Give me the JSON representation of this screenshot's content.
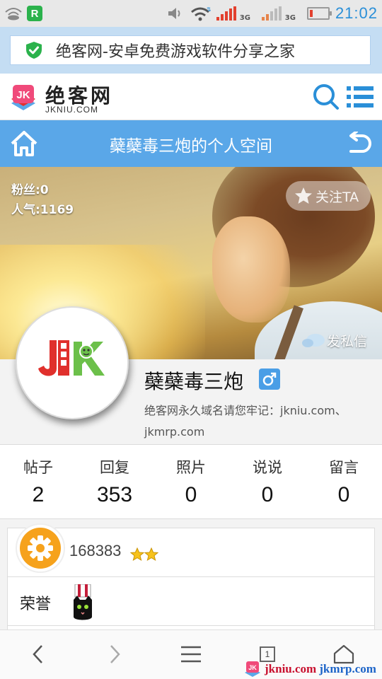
{
  "status_bar": {
    "app_badge": "R",
    "network_tag_1": "3G",
    "network_tag_2": "3G",
    "time": "21:02",
    "battery_level": 0.1
  },
  "banner": {
    "text": "绝客网-安卓免费游戏软件分享之家"
  },
  "header": {
    "logo_cn": "绝客网",
    "logo_en": "JKNIU.COM",
    "logo_mark": "JK"
  },
  "title_bar": {
    "title": "蘗蘗毒三炮的个人空间"
  },
  "cover": {
    "fans": "粉丝:0",
    "popularity": "人气:1169",
    "follow_label": "关注TA",
    "private_message_label": "发私信"
  },
  "profile": {
    "avatar_text": "JK",
    "username": "蘗蘗毒三炮",
    "gender": "male",
    "signature": "绝客网永久域名请您牢记：jkniu.com、jkmrp.com"
  },
  "stats": [
    {
      "label": "帖子",
      "value": "2"
    },
    {
      "label": "回复",
      "value": "353"
    },
    {
      "label": "照片",
      "value": "0"
    },
    {
      "label": "说说",
      "value": "0"
    },
    {
      "label": "留言",
      "value": "0"
    }
  ],
  "details": {
    "uid": "168383",
    "honor_label": "荣誉"
  },
  "bottom_nav": {
    "tab_count": "1"
  },
  "watermark": {
    "domain1": "jkniu.com",
    "domain2": "jkmrp.com"
  },
  "colors": {
    "primary_blue": "#5aa7e8",
    "banner_bg": "#c4ddf3",
    "logo_red": "#e0302c",
    "logo_green": "#6cc04a"
  }
}
